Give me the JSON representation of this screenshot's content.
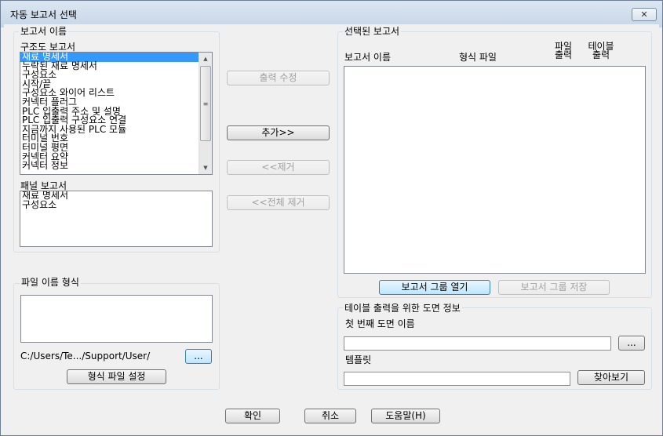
{
  "window": {
    "title": "자동 보고서 선택",
    "close_glyph": "✕"
  },
  "report_names": {
    "legend": "보고서 이름",
    "structure_label": "구조도 보고서",
    "structure_items": [
      "재료 명세서",
      "누락된 재료 명세서",
      "구성요소",
      "시작/끝",
      "구성요소 와이어 리스트",
      "커넥터 플러그",
      "PLC 입출력 주소 및 설명",
      "PLC 입출력 구성요소 연결",
      "지금까지 사용된 PLC 모듈",
      "터미널 번호",
      "터미널 평면",
      "커넥터 요약",
      "커넥터 정보"
    ],
    "selected_index": 0,
    "panel_label": "패널 보고서",
    "panel_items": [
      "재료 명세서",
      "구성요소"
    ]
  },
  "middle_buttons": {
    "edit_output": "출력 수정",
    "add": "추가>>",
    "remove": "<<제거",
    "remove_all": "<<전체 제거"
  },
  "selected_reports": {
    "legend": "선택된 보고서",
    "columns": {
      "report_name": "보고서 이름",
      "format_file": "형식 파일",
      "file_output_line1": "파일",
      "file_output_line2": "출력",
      "table_output_line1": "테이블",
      "table_output_line2": "출력"
    },
    "rows": [],
    "open_group_button": "보고서 그룹 열기",
    "save_group_button": "보고서 그룹 저장"
  },
  "file_name_format": {
    "legend": "파일 이름 형식",
    "path": "C:/Users/Te.../Support/User/",
    "browse_button": "...",
    "set_format_button": "형식 파일 설정"
  },
  "table_drawing_info": {
    "legend": "테이블 출력을 위한 도면 정보",
    "first_drawing_label": "첫 번째 도면 이름",
    "first_drawing_value": "",
    "first_drawing_browse": "...",
    "template_label": "템플릿",
    "template_value": "",
    "template_browse": "찾아보기"
  },
  "footer": {
    "ok": "확인",
    "cancel": "취소",
    "help": "도움말(H)"
  }
}
